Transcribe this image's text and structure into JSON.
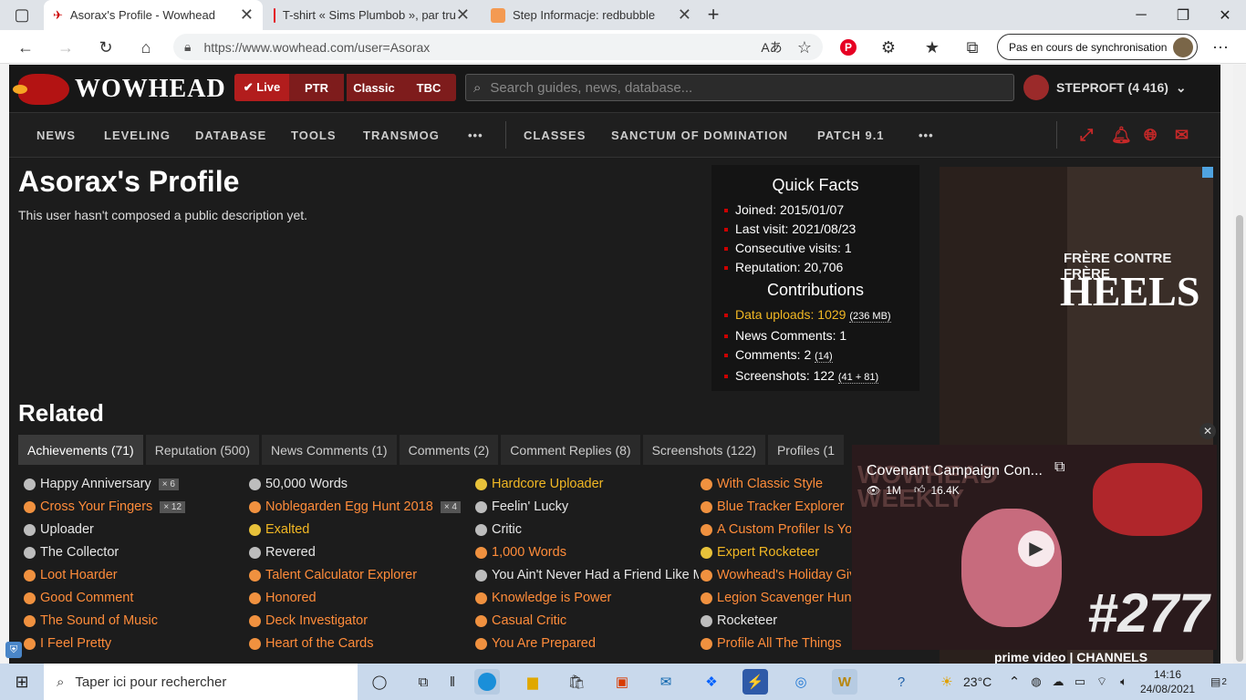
{
  "browser": {
    "tabs": [
      {
        "title": "Asorax's Profile - Wowhead",
        "close": "✕"
      },
      {
        "title": "T-shirt « Sims Plumbob », par tru",
        "close": "✕"
      },
      {
        "title": "Step Informacje: redbubble",
        "close": "✕"
      }
    ],
    "new_tab": "+",
    "url": "https://www.wowhead.com/user=Asorax",
    "sync_label": "Pas en cours de synchronisation"
  },
  "site": {
    "logo": "WOWHEAD",
    "versions": [
      "✔ Live",
      "PTR",
      "Classic",
      "TBC"
    ],
    "search_placeholder": "Search guides, news, database...",
    "user": "STEPROFT (4 416)",
    "menu": [
      "NEWS",
      "LEVELING",
      "DATABASE",
      "TOOLS",
      "TRANSMOG",
      "•••",
      "CLASSES",
      "SANCTUM OF DOMINATION",
      "PATCH 9.1",
      "•••"
    ]
  },
  "profile": {
    "title": "Asorax's Profile",
    "description": "This user hasn't composed a public description yet."
  },
  "quick_facts": {
    "title": "Quick Facts",
    "facts": [
      "Joined: 2015/01/07",
      "Last visit: 2021/08/23",
      "Consecutive visits: 1",
      "Reputation: 20,706"
    ],
    "contrib_title": "Contributions",
    "contribs": [
      {
        "main": "Data uploads: 1029",
        "extra": "(236 MB)"
      },
      {
        "main": "News Comments: 1",
        "extra": ""
      },
      {
        "main": "Comments: 2",
        "extra": "(14)"
      },
      {
        "main": "Screenshots: 122",
        "extra": "(41 + 81)"
      }
    ]
  },
  "related": {
    "title": "Related",
    "tabs": [
      "Achievements (71)",
      "Reputation (500)",
      "News Comments (1)",
      "Comments (2)",
      "Comment Replies (8)",
      "Screenshots (122)",
      "Profiles (1"
    ]
  },
  "achievements": {
    "col1": [
      {
        "name": "Happy Anniversary",
        "badge": "× 6"
      },
      {
        "name": "Cross Your Fingers",
        "badge": "× 12"
      },
      {
        "name": "Uploader",
        "badge": ""
      },
      {
        "name": "The Collector",
        "badge": ""
      },
      {
        "name": "Loot Hoarder",
        "badge": ""
      },
      {
        "name": "Good Comment",
        "badge": ""
      },
      {
        "name": "The Sound of Music",
        "badge": ""
      },
      {
        "name": "I Feel Pretty",
        "badge": ""
      }
    ],
    "col2": [
      {
        "name": "50,000 Words",
        "badge": ""
      },
      {
        "name": "Noblegarden Egg Hunt 2018",
        "badge": "× 4"
      },
      {
        "name": "Exalted",
        "badge": ""
      },
      {
        "name": "Revered",
        "badge": ""
      },
      {
        "name": "Talent Calculator Explorer",
        "badge": ""
      },
      {
        "name": "Honored",
        "badge": ""
      },
      {
        "name": "Deck Investigator",
        "badge": ""
      },
      {
        "name": "Heart of the Cards",
        "badge": ""
      }
    ],
    "col3": [
      {
        "name": "Hardcore Uploader",
        "badge": ""
      },
      {
        "name": "Feelin' Lucky",
        "badge": ""
      },
      {
        "name": "Critic",
        "badge": ""
      },
      {
        "name": "1,000 Words",
        "badge": ""
      },
      {
        "name": "You Ain't Never Had a Friend Like Me",
        "badge": ""
      },
      {
        "name": "Knowledge is Power",
        "badge": ""
      },
      {
        "name": "Casual Critic",
        "badge": ""
      },
      {
        "name": "You Are Prepared",
        "badge": ""
      }
    ],
    "col4": [
      {
        "name": "With Classic Style",
        "badge": ""
      },
      {
        "name": "Blue Tracker Explorer",
        "badge": ""
      },
      {
        "name": "A Custom Profiler Is You",
        "badge": ""
      },
      {
        "name": "Expert Rocketeer",
        "badge": ""
      },
      {
        "name": "Wowhead's Holiday Giving",
        "badge": ""
      },
      {
        "name": "Legion Scavenger Hunt",
        "badge": ""
      },
      {
        "name": "Rocketeer",
        "badge": ""
      },
      {
        "name": "Profile All The Things",
        "badge": ""
      }
    ]
  },
  "colors": {
    "gold": "#f2b824",
    "orange": "#ff8c3a",
    "silver": "#c8c8c8",
    "white": "#ffffff"
  },
  "ad": {
    "line1": "FRÈRE CONTRE FRÈRE",
    "line2": "HEELS",
    "footer": "prime video | CHANNELS"
  },
  "video": {
    "title": "Covenant Campaign Con...",
    "views": "1M",
    "likes": "16.4K",
    "brand": "WOWHEAD WEEKLY",
    "episode": "#277"
  },
  "taskbar": {
    "search": "Taper ici pour rechercher",
    "temp": "23°C",
    "time": "14:16",
    "date": "24/08/2021",
    "notif": "2"
  }
}
